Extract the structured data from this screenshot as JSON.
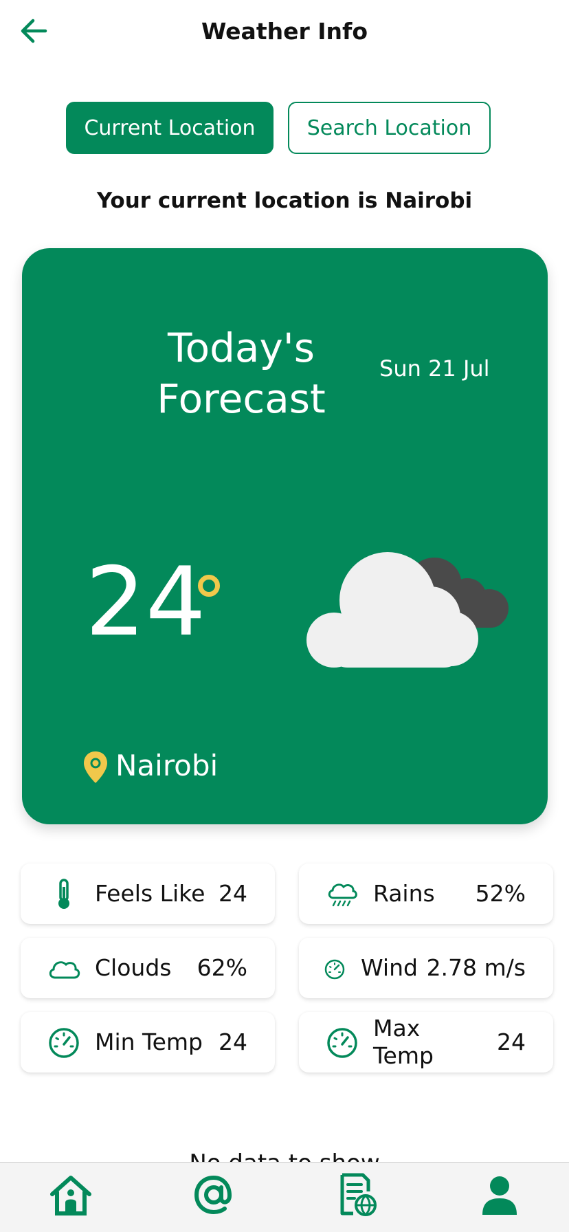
{
  "header": {
    "title": "Weather Info"
  },
  "toggle": {
    "current": "Current Location",
    "search": "Search Location"
  },
  "location_message": "Your current location is Nairobi",
  "forecast": {
    "title": "Today's Forecast",
    "date": "Sun 21 Jul",
    "temperature": "24",
    "city": "Nairobi",
    "condition_icon": "cloud-icon"
  },
  "stats": [
    {
      "label": "Feels Like",
      "value": "24",
      "icon": "thermometer-icon"
    },
    {
      "label": "Rains",
      "value": "52%",
      "icon": "rain-cloud-icon"
    },
    {
      "label": "Clouds",
      "value": "62%",
      "icon": "cloud-icon"
    },
    {
      "label": "Wind",
      "value": "2.78 m/s",
      "icon": "gauge-icon"
    },
    {
      "label": "Min Temp",
      "value": "24",
      "icon": "gauge-icon"
    },
    {
      "label": "Max Temp",
      "value": "24",
      "icon": "gauge-icon"
    }
  ],
  "footer_text": "No data to show",
  "colors": {
    "primary": "#03895a",
    "accent": "#f1c84b",
    "cloud_light": "#f0f0f0",
    "cloud_dark": "#4a4a4a"
  },
  "nav": [
    "home-icon",
    "at-icon",
    "document-globe-icon",
    "profile-icon"
  ]
}
